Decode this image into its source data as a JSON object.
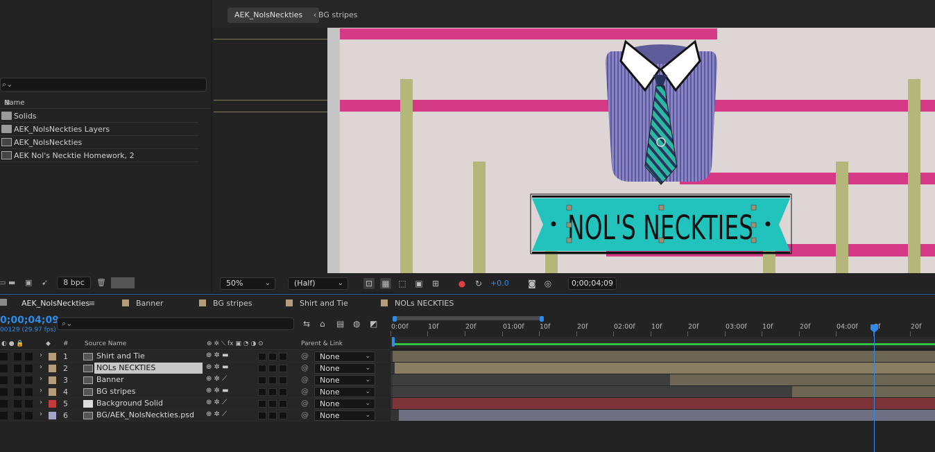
{
  "project": {
    "search_placeholder": "⌕⌄",
    "column_name": "Name",
    "items": [
      {
        "label": "Solids",
        "type": "folder"
      },
      {
        "label": "AEK_NolsNeckties Layers",
        "type": "folder"
      },
      {
        "label": "AEK_NolsNeckties",
        "type": "comp"
      },
      {
        "label": "AEK Nol's Necktie Homework, 2",
        "type": "comp"
      }
    ],
    "bpc": "8 bpc"
  },
  "viewer": {
    "tab_active": "AEK_NolsNeckties",
    "tab_other": "BG stripes",
    "zoom": "50%",
    "resolution": "(Half)",
    "exposure": "+0.0",
    "timecode": "0;00;04;09",
    "banner_text": "NOL'S NECKTIES"
  },
  "timeline": {
    "tabs": [
      {
        "label": "AEK_NolsNeckties",
        "color": "#8a8a8a",
        "active": true
      },
      {
        "label": "Banner",
        "color": "#b59d7c"
      },
      {
        "label": "BG stripes",
        "color": "#b59d7c"
      },
      {
        "label": "Shirt and Tie",
        "color": "#b59d7c"
      },
      {
        "label": "NOLs NECKTIES",
        "color": "#b59d7c"
      }
    ],
    "current_time": "0;00;04;09",
    "frame_info": "00129 (29.97 fps)",
    "search_placeholder": "⌕⌄",
    "col_num": "#",
    "col_source": "Source Name",
    "col_parent": "Parent & Link",
    "ruler_labels": [
      "0:00f",
      "10f",
      "20f",
      "01:00f",
      "10f",
      "20f",
      "02:00f",
      "10f",
      "20f",
      "03:00f",
      "10f",
      "20f",
      "04:00f",
      "0f",
      "20f"
    ],
    "layers": [
      {
        "num": "1",
        "name": "Shirt and Tie",
        "color": "#b59d7c",
        "parent": "None",
        "bar_color": "#6e6654"
      },
      {
        "num": "2",
        "name": "NOLs NECKTIES",
        "color": "#b59d7c",
        "parent": "None",
        "bar_color": "#8a7e62",
        "selected": true
      },
      {
        "num": "3",
        "name": "Banner",
        "color": "#b59d7c",
        "parent": "None",
        "bar_color": "#6e6654"
      },
      {
        "num": "4",
        "name": "BG stripes",
        "color": "#b59d7c",
        "parent": "None",
        "bar_color": "#6e6654"
      },
      {
        "num": "5",
        "name": "Background Solid",
        "color": "#c43c3c",
        "parent": "None",
        "bar_color": "#7d3438"
      },
      {
        "num": "6",
        "name": "BG/AEK_NolsNeckties.psd",
        "color": "#a3a3c8",
        "parent": "None",
        "bar_color": "#6f6f84"
      }
    ]
  }
}
